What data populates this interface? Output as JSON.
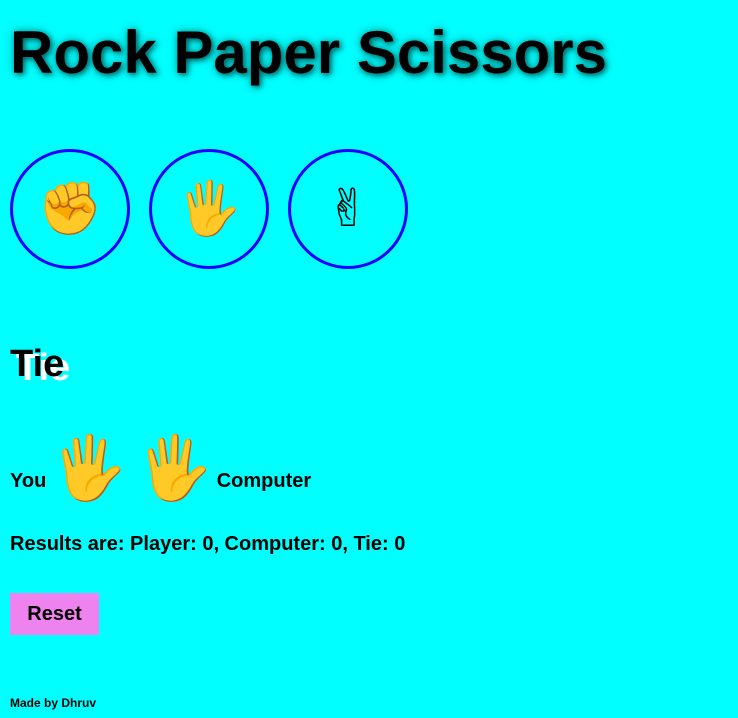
{
  "title": "Rock Paper Scissors",
  "choices": [
    {
      "name": "rock",
      "icon": "✊"
    },
    {
      "name": "paper",
      "icon": "🖐"
    },
    {
      "name": "scissors",
      "icon": "✌"
    }
  ],
  "result": {
    "text": "Tie",
    "player_label": "You",
    "player_pick": "🖐",
    "computer_pick": "🖐",
    "computer_label": "Computer"
  },
  "score": {
    "text": "Results are: Player: 0, Computer: 0, Tie: 0"
  },
  "reset_label": "Reset",
  "footer": "Made by Dhruv",
  "colors": {
    "background": "#00ffff",
    "circle_border": "#1a00ff",
    "reset_button": "#ee82ee"
  }
}
